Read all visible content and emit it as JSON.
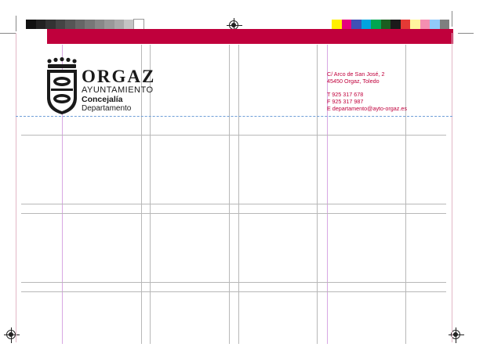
{
  "swatches": {
    "grays": [
      "#111111",
      "#222222",
      "#333333",
      "#444444",
      "#555555",
      "#666666",
      "#777777",
      "#888888",
      "#999999",
      "#aaaaaa",
      "#c4c4c4",
      "#ffffff"
    ],
    "colors": [
      "#ffef00",
      "#e6007e",
      "#3f51b5",
      "#00a3e0",
      "#00a651",
      "#1b5e20",
      "#1a1a1a",
      "#e53935",
      "#fff59d",
      "#f48fb1",
      "#90caf9",
      "#7f7f7f"
    ]
  },
  "brand": {
    "band_color": "#c0003c",
    "contact_color": "#c0003c",
    "guide_blue": "#6f9fd8"
  },
  "logo": {
    "name": "ORGAZ",
    "line1": "AYUNTAMIENTO",
    "line2": "Concejalía",
    "line3": "Departamento",
    "icon": "coat-of-arms-icon"
  },
  "contact": {
    "address1": "C/ Arco de San José, 2",
    "address2": "45450 Orgaz, Toledo",
    "phone": "T  925 317 678",
    "fax": "F  925 317 987",
    "email": "E  departamento@ayto-orgaz.es"
  }
}
